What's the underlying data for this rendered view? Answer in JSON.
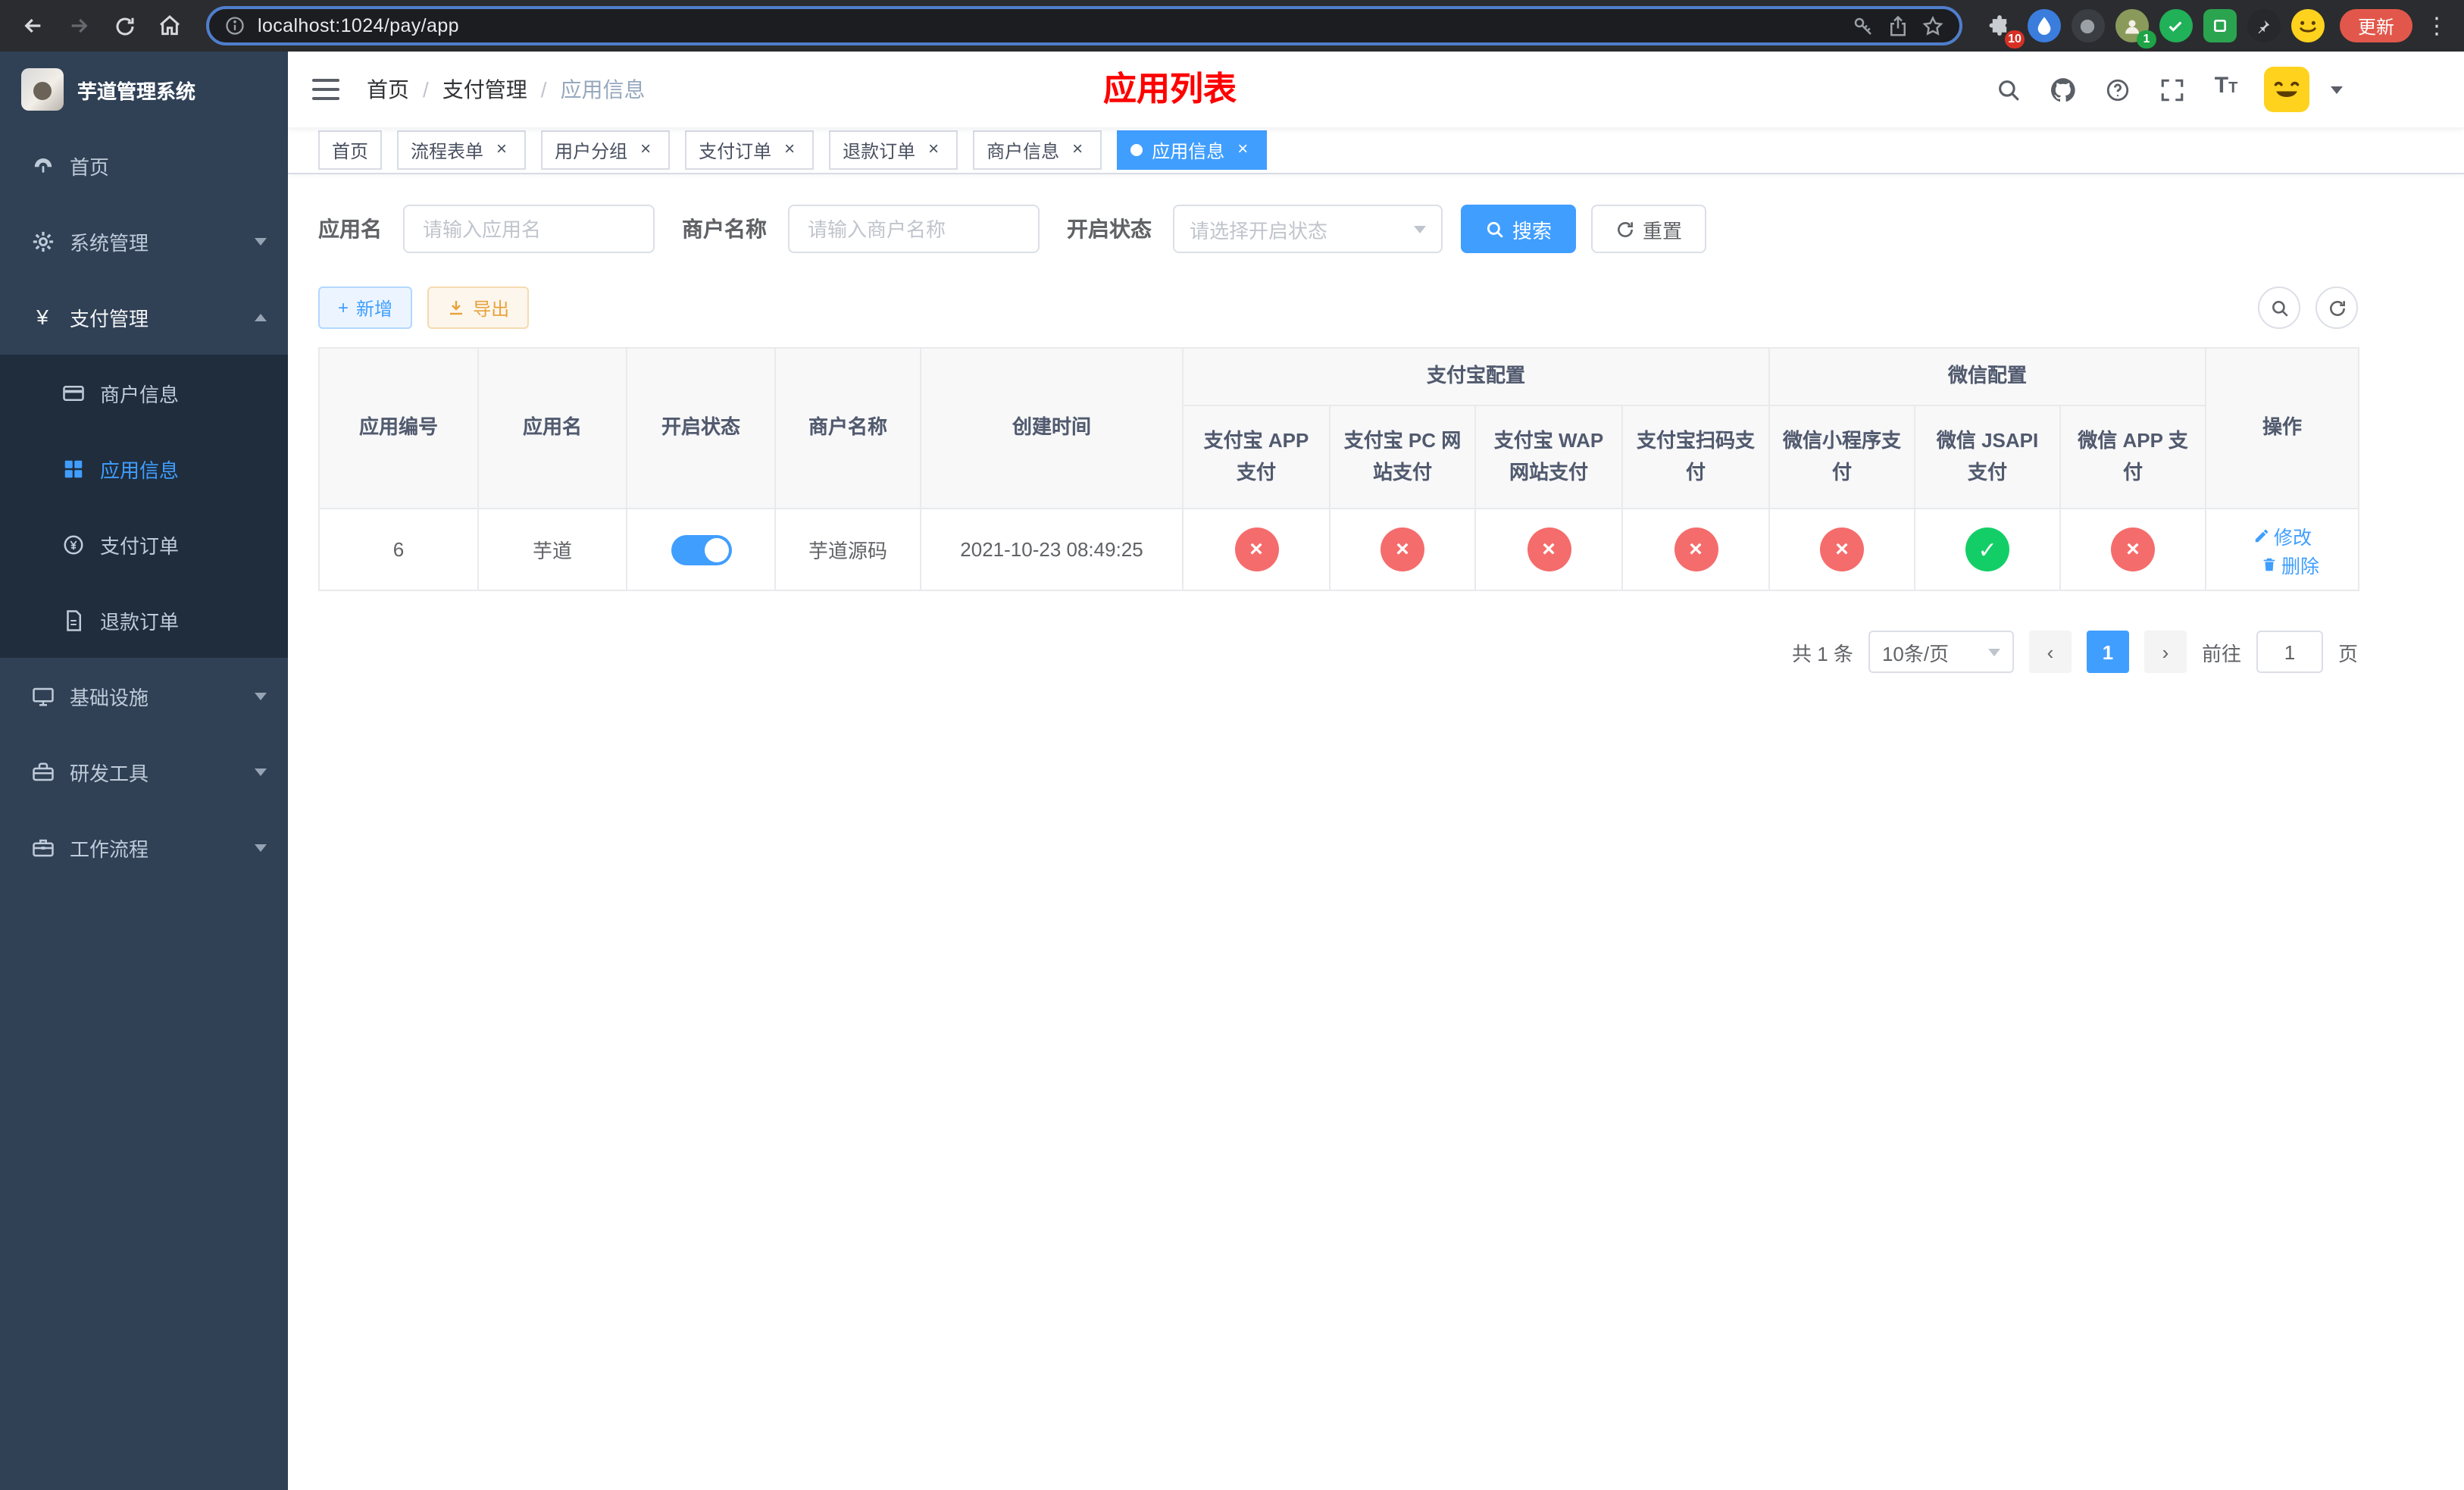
{
  "icons": {
    "close": "×",
    "check": "✓",
    "cross": "×",
    "plus": "+",
    "prev": "‹",
    "next": "›",
    "menu_dots": "⋮",
    "yen": "¥"
  },
  "browser": {
    "url": "localhost:1024/pay/app",
    "update_button_label": "更新",
    "extensions_badge": "10",
    "profile_badge": "1"
  },
  "sidebar": {
    "app_title": "芋道管理系统",
    "menu": [
      {
        "label": "首页",
        "icon": "dashboard-icon"
      },
      {
        "label": "系统管理",
        "icon": "gear-icon",
        "expandable": true
      },
      {
        "label": "支付管理",
        "icon": "yen-icon",
        "expandable": true,
        "expanded": true
      },
      {
        "label": "商户信息",
        "icon": "bank-card-icon",
        "submenu": true
      },
      {
        "label": "应用信息",
        "icon": "grid-icon",
        "submenu": true,
        "active": true
      },
      {
        "label": "支付订单",
        "icon": "pay-order-icon",
        "submenu": true
      },
      {
        "label": "退款订单",
        "icon": "refund-order-icon",
        "submenu": true
      },
      {
        "label": "基础设施",
        "icon": "infrastructure-icon",
        "expandable": true
      },
      {
        "label": "研发工具",
        "icon": "dev-tools-icon",
        "expandable": true
      },
      {
        "label": "工作流程",
        "icon": "workflow-icon",
        "expandable": true
      }
    ]
  },
  "navbar": {
    "breadcrumb": {
      "items": [
        "首页",
        "支付管理",
        "应用信息"
      ],
      "separator": "/"
    },
    "page_title": "应用列表"
  },
  "tags_view": {
    "tabs": [
      {
        "label": "首页",
        "closable": false,
        "active": false
      },
      {
        "label": "流程表单",
        "closable": true,
        "active": false
      },
      {
        "label": "用户分组",
        "closable": true,
        "active": false
      },
      {
        "label": "支付订单",
        "closable": true,
        "active": false
      },
      {
        "label": "退款订单",
        "closable": true,
        "active": false
      },
      {
        "label": "商户信息",
        "closable": true,
        "active": false
      },
      {
        "label": "应用信息",
        "closable": true,
        "active": true
      }
    ]
  },
  "filter": {
    "app_name": {
      "label": "应用名",
      "placeholder": "请输入应用名",
      "value": ""
    },
    "merchant_name": {
      "label": "商户名称",
      "placeholder": "请输入商户名称",
      "value": ""
    },
    "status": {
      "label": "开启状态",
      "placeholder": "请选择开启状态",
      "value": ""
    },
    "search_button": "搜索",
    "reset_button": "重置"
  },
  "toolbar": {
    "add_button": "新增",
    "export_button": "导出"
  },
  "table": {
    "group_headers": {
      "alipay": "支付宝配置",
      "wechat": "微信配置"
    },
    "columns": {
      "app_id": "应用编号",
      "app_name": "应用名",
      "status": "开启状态",
      "merchant": "商户名称",
      "created_at": "创建时间",
      "alipay_app": "支付宝 APP 支付",
      "alipay_pc": "支付宝 PC 网站支付",
      "alipay_wap": "支付宝 WAP 网站支付",
      "alipay_qr": "支付宝扫码支付",
      "wechat_lite": "微信小程序支付",
      "wechat_jsapi": "微信 JSAPI 支付",
      "wechat_app": "微信 APP 支付",
      "operations": "操作"
    },
    "rows": [
      {
        "app_id": "6",
        "app_name": "芋道",
        "status_on": true,
        "merchant": "芋道源码",
        "created_at": "2021-10-23 08:49:25",
        "configs": {
          "alipay_app": false,
          "alipay_pc": false,
          "alipay_wap": false,
          "alipay_qr": false,
          "wechat_lite": false,
          "wechat_jsapi": true,
          "wechat_app": false
        },
        "edit_label": "修改",
        "delete_label": "删除"
      }
    ]
  },
  "pagination": {
    "total_text": "共 1 条",
    "page_size_text": "10条/页",
    "current_page": "1",
    "goto_prefix": "前往",
    "goto_value": "1",
    "goto_suffix": "页"
  },
  "colors": {
    "primary": "#409eff",
    "danger": "#f56c6c",
    "success": "#13ce66",
    "warning": "#e6a23c",
    "title_red": "#ff0000",
    "sidebar_bg": "#304156",
    "sidebar_submenu_bg": "#1f2d3d",
    "update_button_bg": "#e2574b"
  }
}
